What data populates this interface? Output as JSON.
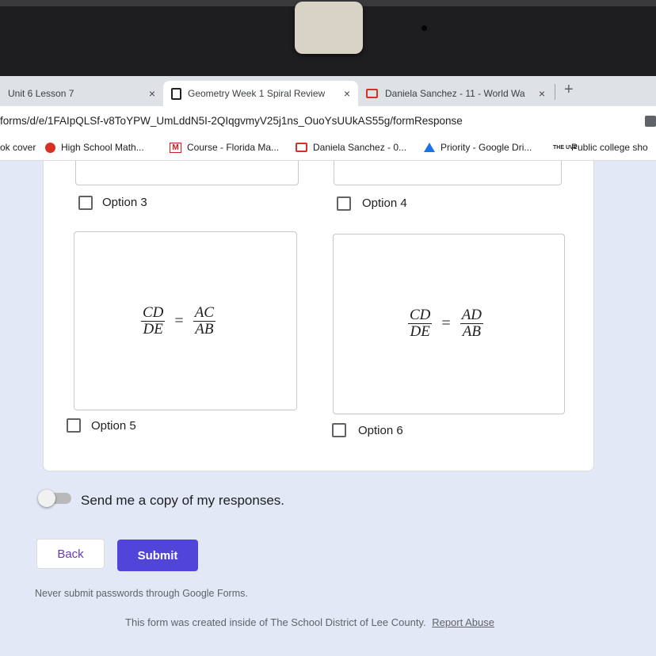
{
  "tabs": [
    {
      "title": "Unit 6 Lesson 7",
      "close": "×"
    },
    {
      "title": "Geometry Week 1 Spiral Review",
      "close": "×"
    },
    {
      "title": "Daniela Sanchez - 11 - World Wa",
      "close": "×"
    }
  ],
  "new_tab_label": "+",
  "address_bar": {
    "url": "forms/d/e/1FAIpQLSf-v8ToYPW_UmLddN5I-2QIqgvmyV25j1ns_OuoYsUUkAS55g/formResponse"
  },
  "bookmarks": [
    {
      "label": "ok cover",
      "icon": "none"
    },
    {
      "label": "High School Math...",
      "icon": "red-dot-icon"
    },
    {
      "label": "Course - Florida Ma...",
      "icon": "mcgraw-hill-icon"
    },
    {
      "label": "Daniela Sanchez - 0...",
      "icon": "classroom-icon"
    },
    {
      "label": "Priority - Google Dri...",
      "icon": "google-drive-icon"
    },
    {
      "label": "Public college sho",
      "icon": "uve-icon",
      "icon_text": "THE UVE"
    }
  ],
  "options": [
    {
      "label": "Option 3"
    },
    {
      "label": "Option 4"
    },
    {
      "label": "Option 5",
      "equation": {
        "lhs_num": "CD",
        "lhs_den": "DE",
        "eq": "=",
        "rhs_num": "AC",
        "rhs_den": "AB"
      }
    },
    {
      "label": "Option 6",
      "equation": {
        "lhs_num": "CD",
        "lhs_den": "DE",
        "eq": "=",
        "rhs_num": "AD",
        "rhs_den": "AB"
      }
    }
  ],
  "send_copy": {
    "label": "Send me a copy of my responses.",
    "checked": false
  },
  "buttons": {
    "back": "Back",
    "submit": "Submit"
  },
  "warning": "Never submit passwords through Google Forms.",
  "footer": {
    "text": "This form was created inside of The School District of Lee County.",
    "report": "Report Abuse"
  },
  "colors": {
    "accent": "#673ab7",
    "submit_bg": "#5144d8",
    "page_bg": "#e3e8f6"
  }
}
